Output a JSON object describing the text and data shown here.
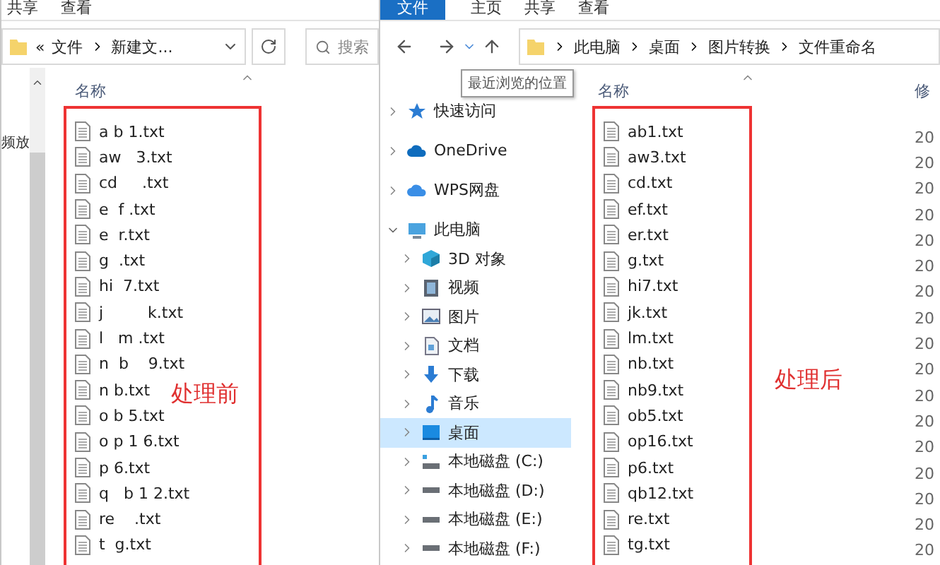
{
  "left_window": {
    "ribbon_tabs": [
      "共享",
      "查看"
    ],
    "address": {
      "overflow": "«",
      "path": [
        "文件",
        "新建文..."
      ]
    },
    "search": {
      "placeholder": "搜索"
    },
    "nav_text": "频放",
    "column": "名称",
    "files": [
      "a b 1.txt",
      "aw   3.txt",
      "cd     .txt",
      "e  f .txt",
      "e  r.txt",
      "g  .txt",
      "hi  7.txt",
      "j         k.txt",
      "l   m .txt",
      "n  b    9.txt",
      "n b.txt",
      "o b 5.txt",
      "o p 1 6.txt",
      "p 6.txt",
      "q   b 1 2.txt",
      "re    .txt",
      "t  g.txt"
    ],
    "annotation": "处理前"
  },
  "right_window": {
    "file_button": "文件",
    "ribbon_tabs": [
      "主页",
      "共享",
      "查看"
    ],
    "address": {
      "path": [
        "此电脑",
        "桌面",
        "图片转换",
        "文件重命名"
      ]
    },
    "tooltip": "最近浏览的位置",
    "nav_items": [
      {
        "label": "快速访问",
        "kind": "star",
        "expanded": false,
        "selected": false
      },
      {
        "label": "OneDrive",
        "kind": "cloud",
        "expanded": false,
        "selected": false
      },
      {
        "label": "WPS网盘",
        "kind": "cloud2",
        "expanded": false,
        "selected": false
      },
      {
        "label": "此电脑",
        "kind": "computer",
        "expanded": true,
        "selected": false,
        "children": [
          {
            "label": "3D 对象",
            "kind": "cube",
            "expanded": false,
            "selected": false
          },
          {
            "label": "视频",
            "kind": "video",
            "expanded": false,
            "selected": false
          },
          {
            "label": "图片",
            "kind": "picture",
            "expanded": false,
            "selected": false
          },
          {
            "label": "文档",
            "kind": "doc",
            "expanded": false,
            "selected": false
          },
          {
            "label": "下载",
            "kind": "download",
            "expanded": false,
            "selected": false
          },
          {
            "label": "音乐",
            "kind": "music",
            "expanded": false,
            "selected": false
          },
          {
            "label": "桌面",
            "kind": "desktop",
            "expanded": false,
            "selected": true
          },
          {
            "label": "本地磁盘 (C:)",
            "kind": "system-disk",
            "expanded": false,
            "selected": false
          },
          {
            "label": "本地磁盘 (D:)",
            "kind": "disk",
            "expanded": false,
            "selected": false
          },
          {
            "label": "本地磁盘 (E:)",
            "kind": "disk",
            "expanded": false,
            "selected": false
          },
          {
            "label": "本地磁盘 (F:)",
            "kind": "disk",
            "expanded": false,
            "selected": false
          }
        ]
      }
    ],
    "columns": [
      "名称",
      "修"
    ],
    "files": [
      {
        "name": "ab1.txt",
        "date": "20"
      },
      {
        "name": "aw3.txt",
        "date": "20"
      },
      {
        "name": "cd.txt",
        "date": "20"
      },
      {
        "name": "ef.txt",
        "date": "20"
      },
      {
        "name": "er.txt",
        "date": "20"
      },
      {
        "name": "g.txt",
        "date": "20"
      },
      {
        "name": "hi7.txt",
        "date": "20"
      },
      {
        "name": "jk.txt",
        "date": "20"
      },
      {
        "name": "lm.txt",
        "date": "20"
      },
      {
        "name": "nb.txt",
        "date": "20"
      },
      {
        "name": "nb9.txt",
        "date": "20"
      },
      {
        "name": "ob5.txt",
        "date": "20"
      },
      {
        "name": "op16.txt",
        "date": "20"
      },
      {
        "name": "p6.txt",
        "date": "20"
      },
      {
        "name": "qb12.txt",
        "date": "20"
      },
      {
        "name": "re.txt",
        "date": "20"
      },
      {
        "name": "tg.txt",
        "date": "20"
      }
    ],
    "annotation": "处理后"
  }
}
